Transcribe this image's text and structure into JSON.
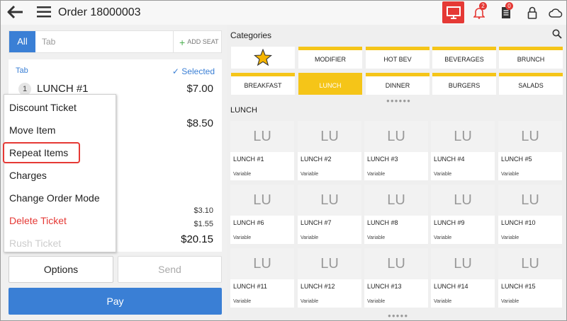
{
  "header": {
    "title": "Order 18000003",
    "notifications_count": "2",
    "tickets_count": "0",
    "accent_color": "#e53935"
  },
  "left": {
    "tabs": {
      "all_label": "All",
      "tab_placeholder": "Tab",
      "add_seat_label": "ADD SEAT"
    },
    "ticket": {
      "tab_label": "Tab",
      "selected_label": "Selected",
      "items": [
        {
          "qty": "1",
          "name": "LUNCH #1",
          "price": "$7.00"
        },
        {
          "price": "$8.50"
        }
      ],
      "tax": "$3.10",
      "tip": "$1.55",
      "total": "$20.15"
    },
    "menu": {
      "items": [
        "Discount Ticket",
        "Move Item",
        "Repeat Items",
        "Charges",
        "Change Order Mode",
        "Delete Ticket",
        "Rush Ticket"
      ],
      "highlighted": "Repeat Items"
    },
    "buttons": {
      "options": "Options",
      "send": "Send",
      "pay": "Pay"
    },
    "primary_color": "#3a7fd5"
  },
  "categories": {
    "heading": "Categories",
    "tiles": [
      "MODIFIER",
      "HOT BEV",
      "BEVERAGES",
      "BRUNCH",
      "BREAKFAST",
      "LUNCH",
      "DINNER",
      "BURGERS",
      "SALADS"
    ],
    "selected": "LUNCH",
    "favorite_icon": "star-icon",
    "accent_color": "#f5c518"
  },
  "products": {
    "heading": "LUNCH",
    "thumb_text": "LU",
    "price_note": "Variable",
    "items": [
      "LUNCH #1",
      "LUNCH #2",
      "LUNCH #3",
      "LUNCH #4",
      "LUNCH #5",
      "LUNCH #6",
      "LUNCH #7",
      "LUNCH #8",
      "LUNCH #9",
      "LUNCH #10",
      "LUNCH #11",
      "LUNCH #12",
      "LUNCH #13",
      "LUNCH #14",
      "LUNCH #15"
    ]
  },
  "pagination": {
    "categories_dots": "●●●●●●",
    "products_dots": "●●●●●"
  }
}
